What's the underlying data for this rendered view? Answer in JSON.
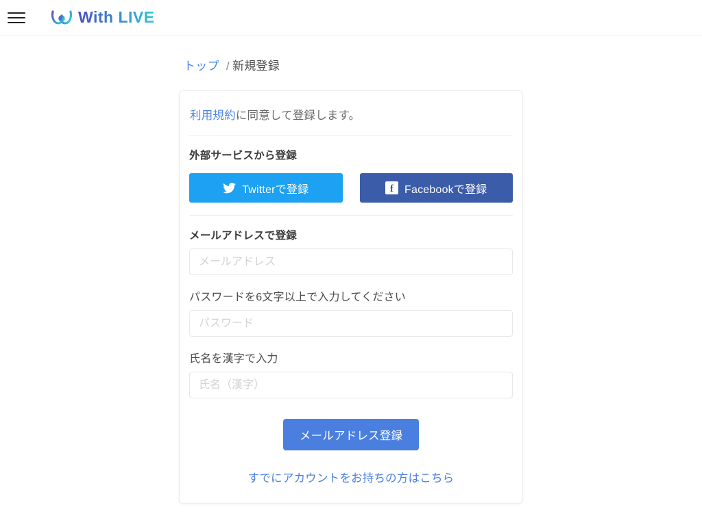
{
  "header": {
    "menu_icon": "hamburger-icon",
    "brand_name": "With LIVE",
    "brand_mark_icon": "withlive-logo-mark",
    "brand_gradient_start": "#5b53c4",
    "brand_gradient_end": "#2fc4d8"
  },
  "breadcrumb": {
    "home_label": "トップ",
    "separator": "/",
    "current_label": "新規登録"
  },
  "card": {
    "terms": {
      "link_label": "利用規約",
      "rest_text": "に同意して登録します。"
    },
    "social_section": {
      "title": "外部サービスから登録",
      "twitter_button": {
        "label": "Twitterで登録",
        "icon": "twitter-bird-icon",
        "color": "#1da1f2"
      },
      "facebook_button": {
        "label": "Facebookで登録",
        "icon": "facebook-f-icon",
        "glyph": "f",
        "color": "#3b5ca8"
      }
    },
    "email_section": {
      "title": "メールアドレスで登録",
      "email_field": {
        "placeholder": "メールアドレス",
        "value": ""
      },
      "password_label": "パスワードを6文字以上で入力してください",
      "password_field": {
        "placeholder": "パスワード",
        "value": ""
      },
      "name_label": "氏名を漢字で入力",
      "name_field": {
        "placeholder": "氏名（漢字）",
        "value": ""
      },
      "submit_label": "メールアドレス登録",
      "submit_color": "#4a7fe0"
    },
    "login_link_label": "すでにアカウントをお持ちの方はこちら"
  }
}
